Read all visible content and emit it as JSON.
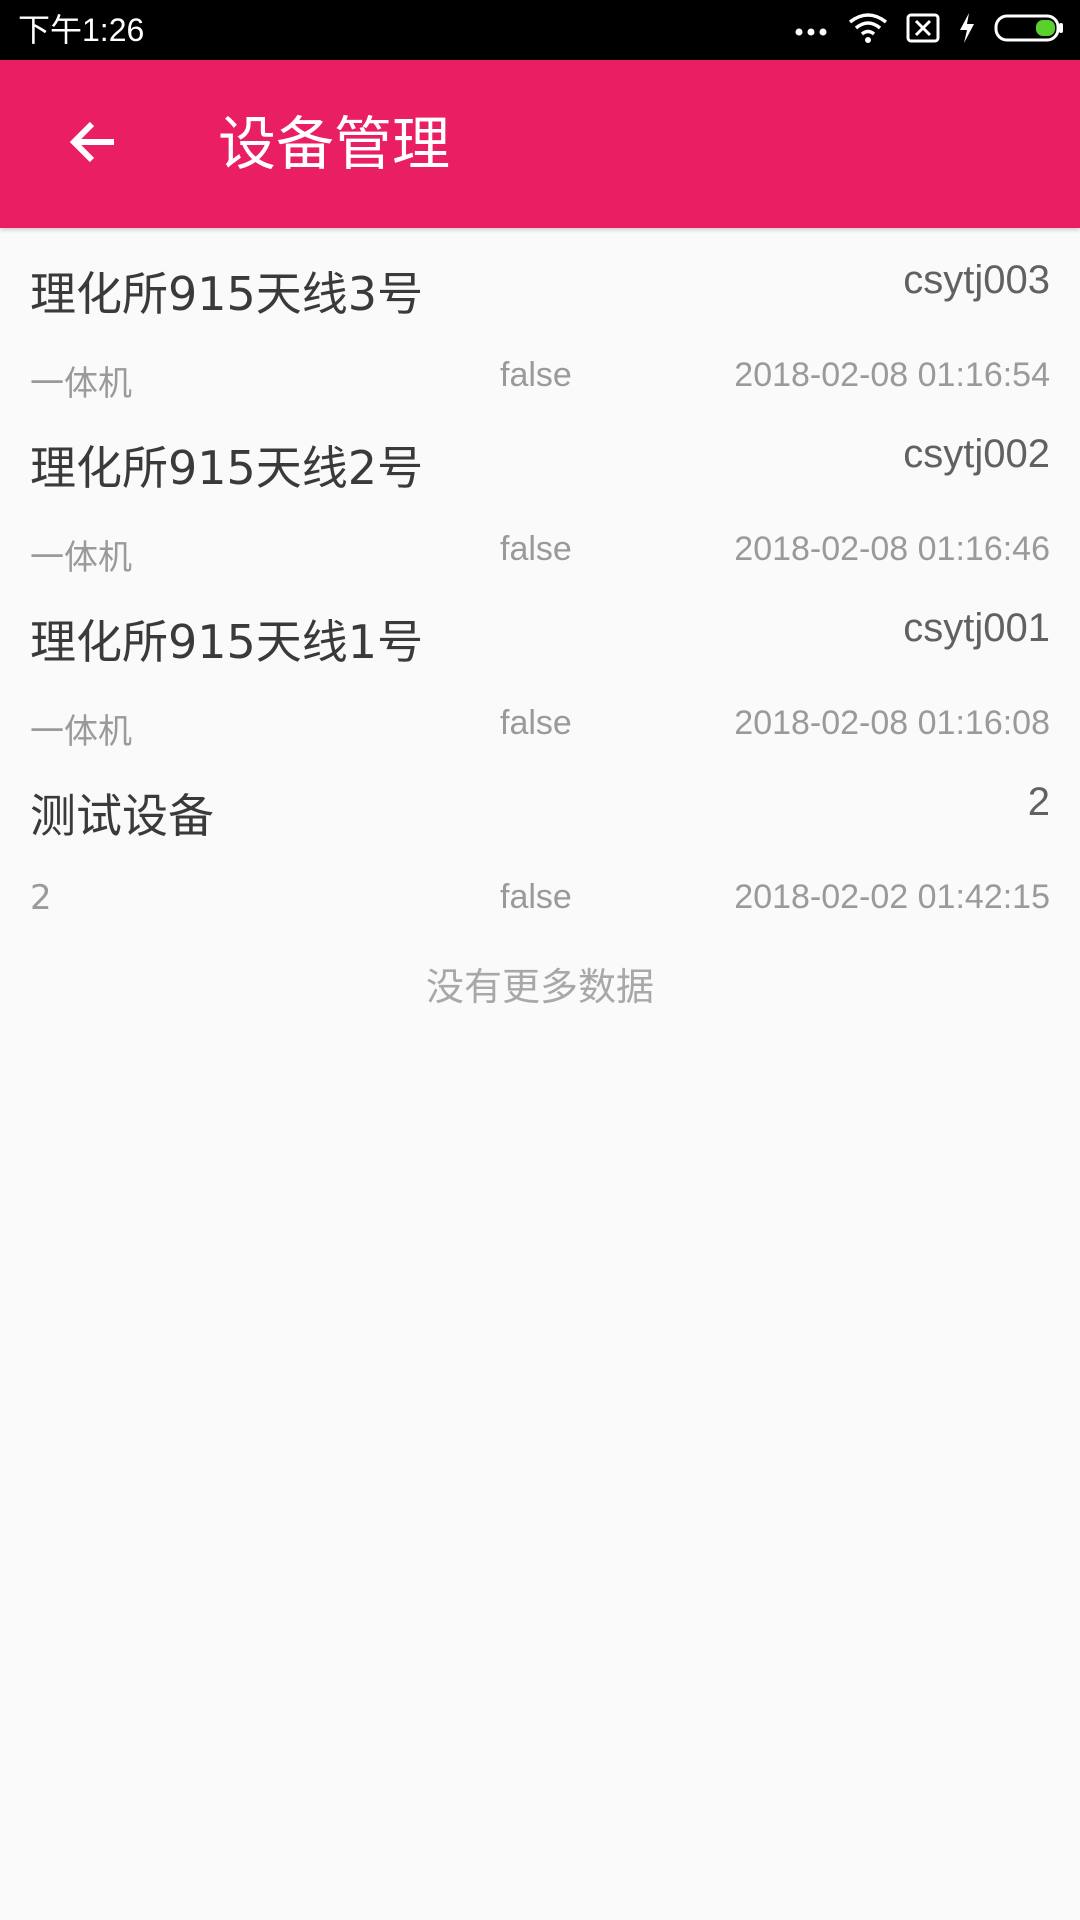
{
  "status_bar": {
    "time": "下午1:26",
    "icons": [
      "more-dots-icon",
      "wifi-icon",
      "sim-off-icon",
      "charging-icon",
      "battery-icon"
    ]
  },
  "app_bar": {
    "title": "设备管理",
    "back_icon": "arrow-left-icon",
    "color": "#e91e63"
  },
  "devices": [
    {
      "name": "理化所915天线3号",
      "code": "csytj003",
      "type": "一体机",
      "status": "false",
      "time": "2018-02-08 01:16:54"
    },
    {
      "name": "理化所915天线2号",
      "code": "csytj002",
      "type": "一体机",
      "status": "false",
      "time": "2018-02-08 01:16:46"
    },
    {
      "name": "理化所915天线1号",
      "code": "csytj001",
      "type": "一体机",
      "status": "false",
      "time": "2018-02-08 01:16:08"
    },
    {
      "name": "测试设备",
      "code": "2",
      "type": "2",
      "status": "false",
      "time": "2018-02-02 01:42:15"
    }
  ],
  "footer": {
    "no_more_text": "没有更多数据"
  }
}
